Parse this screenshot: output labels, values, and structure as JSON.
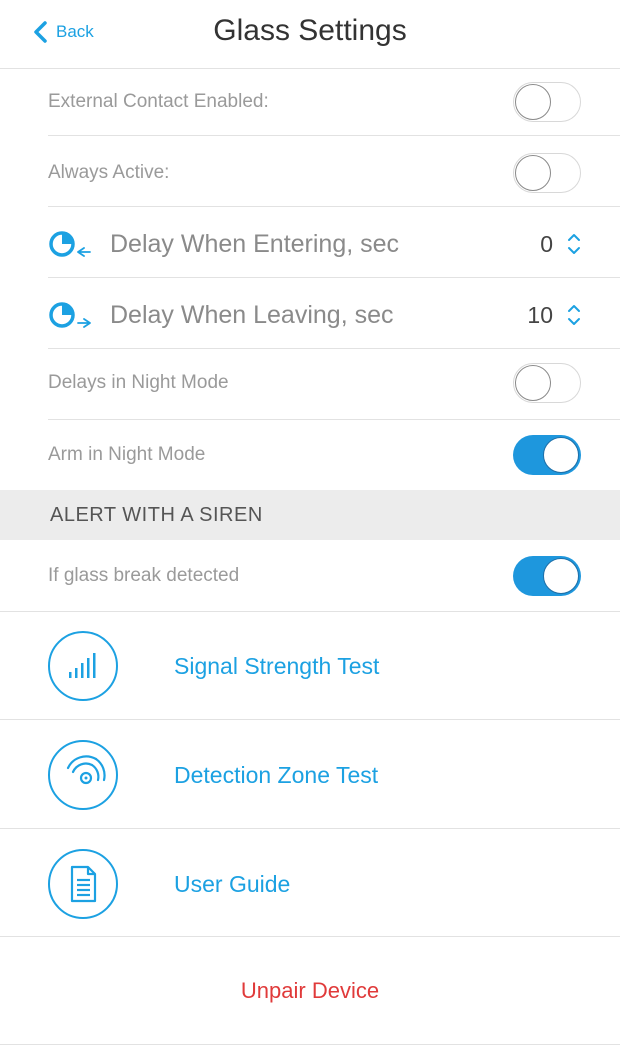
{
  "header": {
    "back_label": "Back",
    "title": "Glass Settings"
  },
  "settings": {
    "external_contact": {
      "label": "External Contact Enabled:",
      "on": false
    },
    "always_active": {
      "label": "Always Active:",
      "on": false
    },
    "delay_entering": {
      "label": "Delay When Entering, sec",
      "value": "0"
    },
    "delay_leaving": {
      "label": "Delay When Leaving, sec",
      "value": "10"
    },
    "delays_night": {
      "label": "Delays in Night Mode",
      "on": false
    },
    "arm_night": {
      "label": "Arm in Night Mode",
      "on": true
    }
  },
  "siren": {
    "section_title": "ALERT WITH A SIREN",
    "glass_break": {
      "label": "If glass break detected",
      "on": true
    }
  },
  "actions": [
    {
      "label": "Signal Strength Test",
      "icon": "signal-strength-icon"
    },
    {
      "label": "Detection Zone Test",
      "icon": "detection-zone-icon"
    },
    {
      "label": "User Guide",
      "icon": "document-icon"
    }
  ],
  "unpair_label": "Unpair Device",
  "colors": {
    "accent": "#1ca1e2",
    "toggle_on": "#1e97dd",
    "danger": "#e03a3a"
  }
}
